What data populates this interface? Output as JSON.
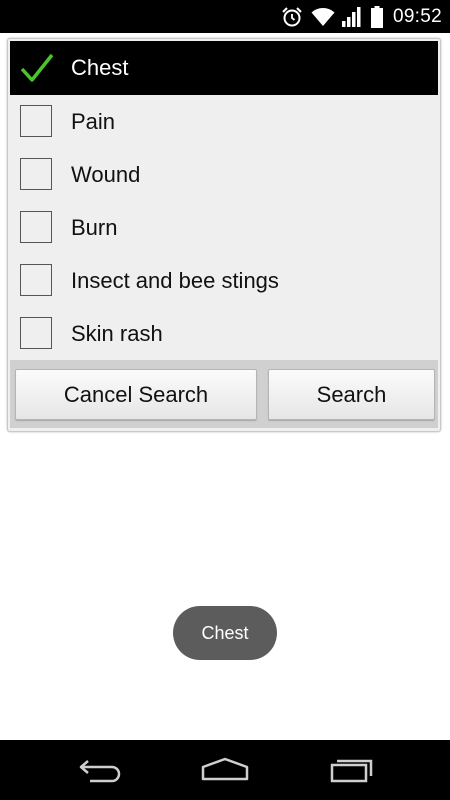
{
  "status_bar": {
    "time": "09:52",
    "icons": [
      "alarm-icon",
      "wifi-icon",
      "signal-icon",
      "battery-icon"
    ]
  },
  "dialog": {
    "items": [
      {
        "label": "Chest",
        "checked": true
      },
      {
        "label": "Pain",
        "checked": false
      },
      {
        "label": "Wound",
        "checked": false
      },
      {
        "label": "Burn",
        "checked": false
      },
      {
        "label": "Insect and bee stings",
        "checked": false
      },
      {
        "label": "Skin rash",
        "checked": false
      }
    ],
    "buttons": {
      "cancel_label": "Cancel Search",
      "search_label": "Search"
    }
  },
  "toast": {
    "text": "Chest"
  },
  "nav_bar": {
    "icons": [
      "back-icon",
      "home-icon",
      "recent-apps-icon"
    ]
  },
  "colors": {
    "selected_row": "#000000",
    "checkmark": "#4cc52a",
    "dialog_bg": "#efefef",
    "toast_bg": "#5c5c5c"
  }
}
